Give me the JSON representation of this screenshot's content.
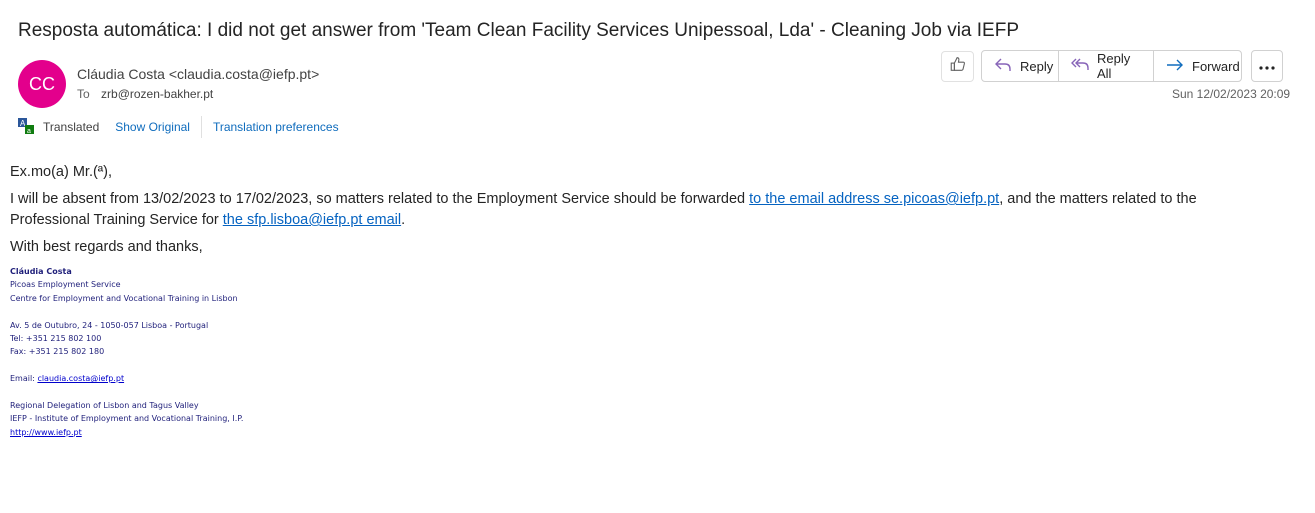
{
  "email": {
    "subject": "Resposta automática: I did not get answer from 'Team Clean Facility Services Unipessoal, Lda'  - Cleaning Job via IEFP",
    "avatar_initials": "CC",
    "avatar_color": "#e3008c",
    "sender": "Cláudia Costa <claudia.costa@iefp.pt>",
    "to_label": "To",
    "to_address": "zrb@rozen-bakher.pt",
    "date": "Sun 12/02/2023 20:09"
  },
  "actions": {
    "like_icon": "thumbs-up-icon",
    "reply_label": "Reply",
    "reply_all_label": "Reply All",
    "forward_label": "Forward",
    "more_icon": "more-horizontal-icon"
  },
  "translation": {
    "status": "Translated",
    "show_original": "Show Original",
    "preferences": "Translation preferences"
  },
  "body": {
    "greeting": "Ex.mo(a) Mr.(ª),",
    "para_start": "I will be absent from 13/02/2023 to 17/02/2023, so matters related to the Employment Service should be forwarded ",
    "link1": "to the email address se.picoas@iefp.pt",
    "para_mid": ", and the matters related to the Professional Training Service for ",
    "link2": "the sfp.lisboa@iefp.pt email",
    "para_end": ".",
    "closing": "With best regards and thanks,"
  },
  "signature": {
    "name": "Cláudia Costa",
    "service": "Picoas Employment Service",
    "centre": "Centre for Employment and Vocational Training in Lisbon",
    "address": "Av. 5 de Outubro, 24 - 1050-057 Lisboa - Portugal",
    "tel": "Tel: +351 215 802 100",
    "fax": "Fax: +351 215 802 180",
    "email_label": "Email: ",
    "email": "claudia.costa@iefp.pt",
    "delegation": "Regional Delegation of Lisbon and Tagus Valley",
    "institute": "IEFP - Institute of Employment and Vocational Training, I.P.",
    "website": "http://www.iefp.pt"
  }
}
